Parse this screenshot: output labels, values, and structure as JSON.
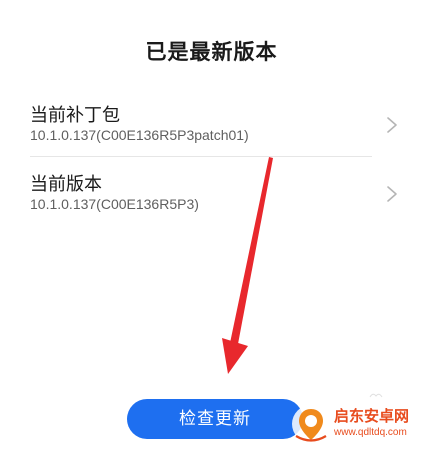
{
  "header": {
    "title": "已是最新版本"
  },
  "items": [
    {
      "label": "当前补丁包",
      "value": "10.1.0.137(C00E136R5P3patch01)"
    },
    {
      "label": "当前版本",
      "value": "10.1.0.137(C00E136R5P3)"
    }
  ],
  "footer": {
    "check_update_label": "检查更新"
  },
  "watermark": {
    "name": "启东安卓网",
    "url": "www.qdltdq.com"
  },
  "colors": {
    "accent": "#1e6ff0",
    "annotation_arrow": "#e8282d",
    "watermark": "#e84c1e"
  },
  "icons": {
    "row_chevron": "chevron-right-icon",
    "watermark_logo": "location-pin-logo"
  }
}
